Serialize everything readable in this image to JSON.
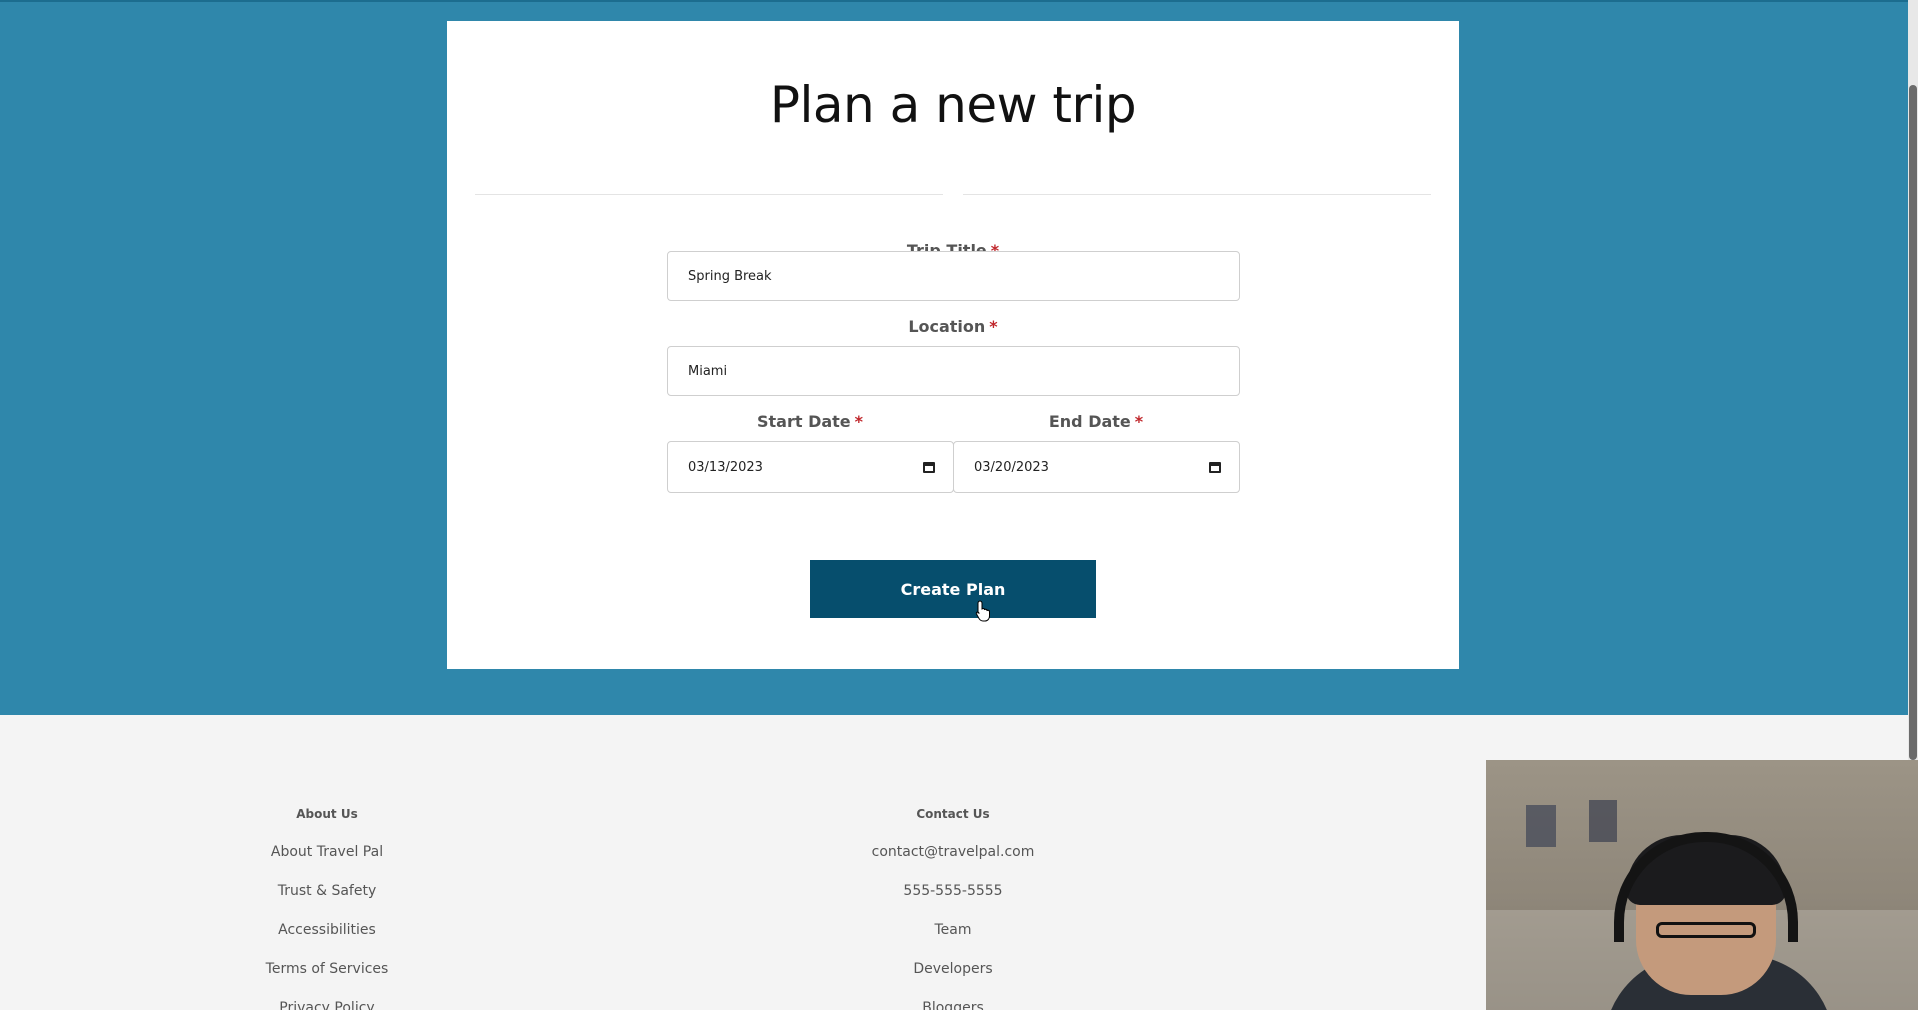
{
  "form": {
    "title": "Plan a new trip",
    "required_marker": "*",
    "trip_title": {
      "label": "Trip Title",
      "value": "Spring Break"
    },
    "location": {
      "label": "Location",
      "value": "Miami"
    },
    "start_date": {
      "label": "Start Date",
      "value": "03/13/2023"
    },
    "end_date": {
      "label": "End Date",
      "value": "03/20/2023"
    },
    "submit_label": "Create Plan"
  },
  "footer": {
    "about": {
      "heading": "About Us",
      "links": [
        "About Travel Pal",
        "Trust & Safety",
        "Accessibilities",
        "Terms of Services",
        "Privacy Policy"
      ]
    },
    "contact": {
      "heading": "Contact Us",
      "links": [
        "contact@travelpal.com",
        "555-555-5555",
        "Team",
        "Developers",
        "Bloggers"
      ]
    }
  },
  "colors": {
    "hero_background": "#2f87ab",
    "button_background": "#064e6d",
    "required_marker": "#c0262b",
    "footer_background": "#f4f4f4"
  },
  "icons": {
    "date_picker": "calendar-icon",
    "cursor": "hand-pointer-cursor"
  }
}
